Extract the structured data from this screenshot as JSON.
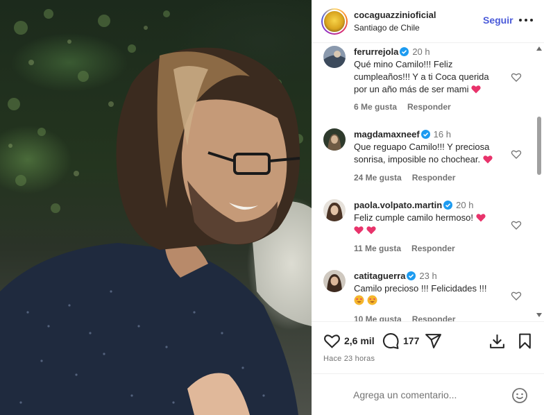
{
  "post": {
    "username": "cocaguazzinioficial",
    "location": "Santiago de Chile",
    "follow_label": "Seguir",
    "more_icon": "more-horizontal-icon",
    "likes": "2,6 mil",
    "comments_count": "177",
    "time_ago": "Hace 23 horas"
  },
  "comments": [
    {
      "username": "ferurrejola",
      "verified": true,
      "time": "20 h",
      "text": "Qué mino Camilo!!! Feliz cumpleaños!!! Y a ti Coca querida por un año más de ser mami",
      "emoji": "heart-emoji",
      "likes": "6 Me gusta",
      "reply": "Responder"
    },
    {
      "username": "magdamaxneef",
      "verified": true,
      "time": "16 h",
      "text": "Que reguapo Camilo!!! Y preciosa sonrisa, imposible no chochear.",
      "emoji": "heart-emoji",
      "likes": "24 Me gusta",
      "reply": "Responder"
    },
    {
      "username": "paola.volpato.martin",
      "verified": true,
      "time": "20 h",
      "text": "Feliz cumple camilo hermoso!",
      "emoji": "heart-emoji x3",
      "likes": "11 Me gusta",
      "reply": "Responder"
    },
    {
      "username": "catitaguerra",
      "verified": true,
      "time": "23 h",
      "text": "Camilo precioso !!! Felicidades !!!",
      "emoji": "heart-eyes-emoji x2",
      "likes": "10 Me gusta",
      "reply": "Responder"
    }
  ],
  "composer": {
    "placeholder": "Agrega un comentario...",
    "emoji_icon": "smiley-icon"
  },
  "colors": {
    "accent": "#4a5ad9",
    "verified": "#1d9bf0",
    "heart_emoji": "#e8336b",
    "muted": "#737373"
  }
}
